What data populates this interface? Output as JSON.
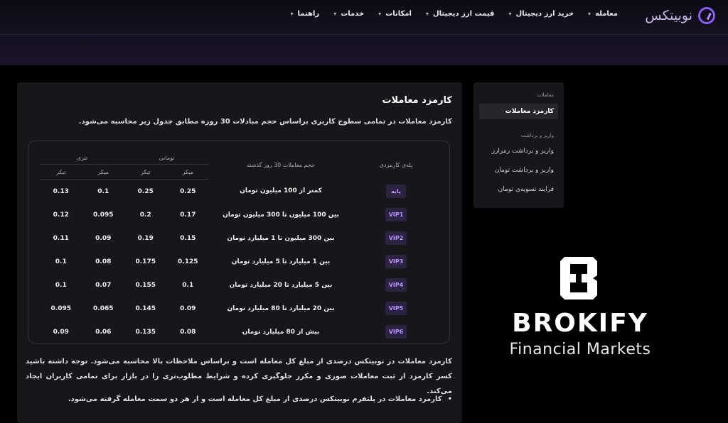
{
  "header": {
    "logo_text": "نوبیتکس",
    "nav": [
      {
        "label": "معامله"
      },
      {
        "label": "خرید ارز دیجیتال"
      },
      {
        "label": "قیمت ارز دیجیتال"
      },
      {
        "label": "امکانات"
      },
      {
        "label": "خدمات"
      },
      {
        "label": "راهنما"
      }
    ],
    "accent_color": "#8a5cf6"
  },
  "main": {
    "title": "کارمزد معاملات",
    "subtitle": "کارمزد معاملات در تمامی سطوح کاربری براساس حجم مبادلات 30 روزه مطابق جدول زیر محاسبه می‌شود.",
    "table": {
      "col_level": "پله‌ی کارمزدی",
      "col_volume": "حجم معاملات 30 روز گذشته",
      "group_toman": "تومانی",
      "group_tether": "تتری",
      "maker": "میکر",
      "taker": "تیکر",
      "rows": [
        {
          "level": "پایه",
          "volume": "کمتر از 100 میلیون تومان",
          "toman_maker": "0.25",
          "toman_taker": "0.25",
          "tether_maker": "0.1",
          "tether_taker": "0.13"
        },
        {
          "level": "VIP1",
          "volume": "بین 100 میلیون تا 300 میلیون تومان",
          "toman_maker": "0.17",
          "toman_taker": "0.2",
          "tether_maker": "0.095",
          "tether_taker": "0.12"
        },
        {
          "level": "VIP2",
          "volume": "بین 300 میلیون تا 1 میلیارد تومان",
          "toman_maker": "0.15",
          "toman_taker": "0.19",
          "tether_maker": "0.09",
          "tether_taker": "0.11"
        },
        {
          "level": "VIP3",
          "volume": "بین 1 میلیارد تا 5 میلیارد تومان",
          "toman_maker": "0.125",
          "toman_taker": "0.175",
          "tether_maker": "0.08",
          "tether_taker": "0.1"
        },
        {
          "level": "VIP4",
          "volume": "بین 5 میلیارد تا 20 میلیارد تومان",
          "toman_maker": "0.1",
          "toman_taker": "0.155",
          "tether_maker": "0.07",
          "tether_taker": "0.1"
        },
        {
          "level": "VIP5",
          "volume": "بین 20 میلیارد تا 80 میلیارد تومان",
          "toman_maker": "0.09",
          "toman_taker": "0.145",
          "tether_maker": "0.065",
          "tether_taker": "0.095"
        },
        {
          "level": "VIP6",
          "volume": "بیش از 80 میلیارد تومان",
          "toman_maker": "0.08",
          "toman_taker": "0.135",
          "tether_maker": "0.06",
          "tether_taker": "0.09"
        }
      ]
    },
    "paragraph": "کارمزد معاملات در نوبیتکس درصدی از مبلغ کل معامله است و براساس ملاحظات بالا محاسبه می‌شود. توجه داشته باشید کسر کارمزد از ثبت معاملات صوری و مکرر جلوگیری کرده و شرایط مطلوب‌تری را در بازار برای تمامی کاربران ایجاد می‌کند.",
    "bullet": "کارمزد معاملات در پلتفرم نوبیتکس درصدی از مبلغ کل معامله است و از هر دو سمت معامله گرفته می‌شود."
  },
  "sidebar": {
    "section1": "معاملات",
    "item_active": "کارمزد معاملات",
    "section2": "واریز و برداشت",
    "items": [
      {
        "label": "واریز و برداشت رمزارز"
      },
      {
        "label": "واریز و برداشت تومان"
      },
      {
        "label": "فرایند تسویه‌ی تومان"
      }
    ]
  },
  "watermark": {
    "name": "BROKIFY",
    "tagline": "Financial Markets"
  }
}
